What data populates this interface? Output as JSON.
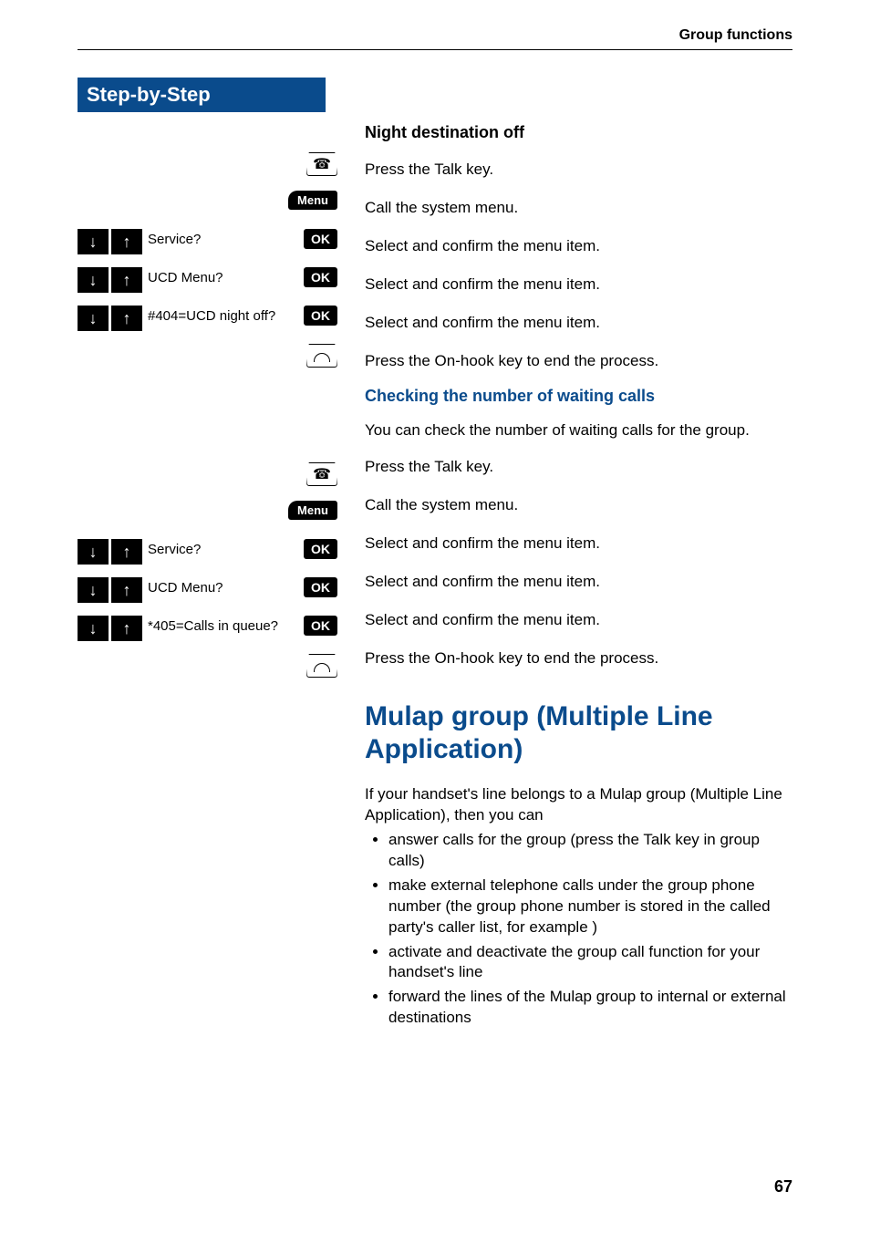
{
  "header": {
    "section": "Group functions"
  },
  "sidebar": {
    "title": "Step-by-Step"
  },
  "sections": {
    "nightOff": {
      "heading": "Night destination off",
      "rows": [
        {
          "left": {
            "type": "talk-key"
          },
          "right": "Press the Talk key."
        },
        {
          "left": {
            "type": "menu-pill",
            "label": "Menu"
          },
          "right": "Call the system menu."
        },
        {
          "left": {
            "type": "nav-ok",
            "text": "Service?",
            "ok": "OK"
          },
          "right": "Select and confirm the menu item."
        },
        {
          "left": {
            "type": "nav-ok",
            "text": "UCD Menu?",
            "ok": "OK"
          },
          "right": "Select and confirm the menu item."
        },
        {
          "left": {
            "type": "nav-ok",
            "text": "#404=UCD night off?",
            "ok": "OK"
          },
          "right": "Select and confirm the menu item."
        },
        {
          "left": {
            "type": "onhook-key"
          },
          "right": "Press the On-hook key to end the process."
        }
      ]
    },
    "checking": {
      "heading": "Checking the number of waiting calls",
      "intro": "You can check the number of waiting calls for the group.",
      "rows": [
        {
          "left": {
            "type": "talk-key"
          },
          "right": "Press the Talk key."
        },
        {
          "left": {
            "type": "menu-pill",
            "label": "Menu"
          },
          "right": "Call the system menu."
        },
        {
          "left": {
            "type": "nav-ok",
            "text": "Service?",
            "ok": "OK"
          },
          "right": "Select and confirm the menu item."
        },
        {
          "left": {
            "type": "nav-ok",
            "text": "UCD Menu?",
            "ok": "OK"
          },
          "right": "Select and confirm the menu item."
        },
        {
          "left": {
            "type": "nav-ok",
            "text": "*405=Calls in queue?",
            "ok": "OK"
          },
          "right": "Select and confirm the menu item."
        },
        {
          "left": {
            "type": "onhook-key"
          },
          "right": "Press the On-hook key to end the process."
        }
      ]
    },
    "mulap": {
      "heading": "Mulap group (Multiple Line Application)",
      "para": "If your handset's line belongs to a Mulap group (Multiple Line Application), then you can",
      "bullets": [
        "answer calls for the group (press the Talk key in group calls)",
        "make external telephone calls under the group phone number (the group phone number is stored in the called party's caller list, for example )",
        "activate and deactivate the group call function for your handset's line",
        "forward the lines of the Mulap group to internal or external destinations"
      ]
    }
  },
  "pageNumber": "67",
  "labels": {
    "menuPill": "Menu",
    "okPill": "OK"
  }
}
